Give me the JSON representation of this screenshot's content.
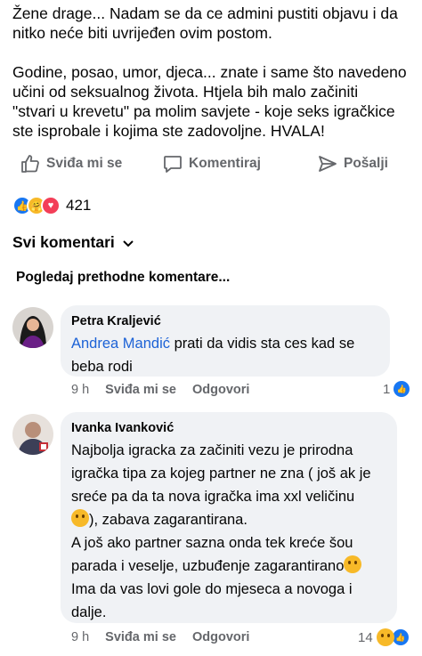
{
  "post": {
    "paragraph1": "Žene drage... Nadam se da ce admini pustiti objavu i da\nnitko neće biti uvrijeđen ovim postom.",
    "paragraph2": "Godine, posao, umor, djeca... znate i same što navedeno\nučini od  seksualnog života. Htjela bih malo začiniti\n\"stvari u krevetu\" pa molim savjete - koje seks igračkice\nste isprobale i kojima ste zadovoljne. HVALA!"
  },
  "actions": {
    "like": "Sviđa mi se",
    "comment": "Komentiraj",
    "share": "Pošalji"
  },
  "reactions": {
    "count": "421",
    "icons": [
      "like-reaction",
      "care-reaction",
      "love-reaction"
    ]
  },
  "comments_header": {
    "sort_label": "Svi komentari",
    "previous_link": "Pogledaj prethodne komentare..."
  },
  "comments": [
    {
      "author": "Petra Kraljević",
      "mention": "Andrea Mandić",
      "text": "  prati da vidis sta ces kad se\nbeba rodi",
      "time": "9 h",
      "like": "Sviđa mi se",
      "reply": "Odgovori",
      "reaction_count": "1"
    },
    {
      "author": "Ivanka Ivanković",
      "text_1": "Najbolja igracka za začiniti vezu je prirodna\nigračka tipa za kojeg partner ne zna ( još ak je\nsreće pa da ta nova igračka ima xxl veličinu",
      "text_2": "), zabava zagarantirana.\nA još ako partner sazna onda tek kreće šou\nparada i veselje, uzbuđenje zagarantirano",
      "text_3": "Ima da vas lovi gole do mjeseca a novoga i\ndalje.",
      "time": "9 h",
      "like": "Sviđa mi se",
      "reply": "Odgovori",
      "reaction_count": "14"
    }
  ],
  "colors": {
    "accent": "#1877f2",
    "mention": "#1c62d6",
    "bubble": "#f0f2f5",
    "muted": "#65676b"
  }
}
